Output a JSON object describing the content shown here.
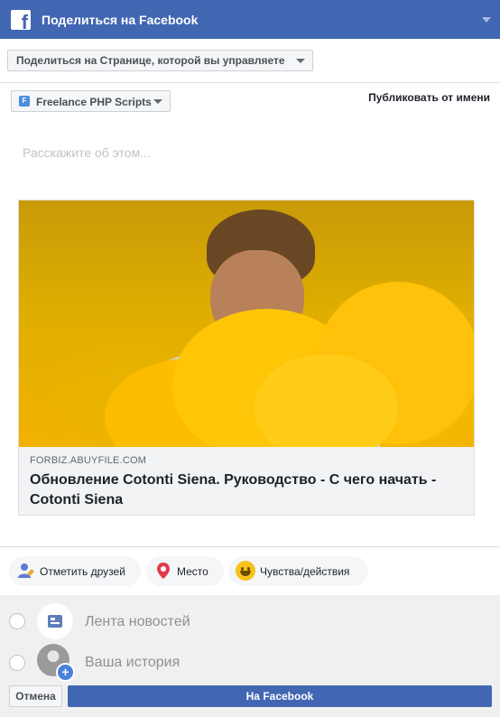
{
  "header": {
    "title": "Поделиться на Facebook",
    "logo_letter": "f"
  },
  "share_target": {
    "selected": "Поделиться на Странице, которой вы управляете"
  },
  "page_select": {
    "icon_letter": "F",
    "selected": "Freelance PHP Scripts"
  },
  "publish_as_label": "Публиковать от имени",
  "composer": {
    "placeholder": "Расскажите об этом..."
  },
  "link_preview": {
    "domain": "FORBIZ.ABUYFILE.COM",
    "title": "Обновление Cotonti Siena. Руководство - С чего начать - Cotonti Siena"
  },
  "actions": [
    {
      "label": "Отметить друзей",
      "icon": "tag-friends-icon"
    },
    {
      "label": "Место",
      "icon": "location-pin-icon"
    },
    {
      "label": "Чувства/действия",
      "icon": "smiley-icon"
    }
  ],
  "destinations": [
    {
      "label": "Лента новостей",
      "icon": "news-feed-icon"
    },
    {
      "label": "Ваша история",
      "icon": "story-avatar-icon"
    }
  ],
  "footer": {
    "cancel_label": "Отмена",
    "post_label": "На Facebook"
  },
  "colors": {
    "brand": "#4267b2",
    "header_bg": "#4267b2",
    "bottom_bg": "#f0f0f0"
  }
}
